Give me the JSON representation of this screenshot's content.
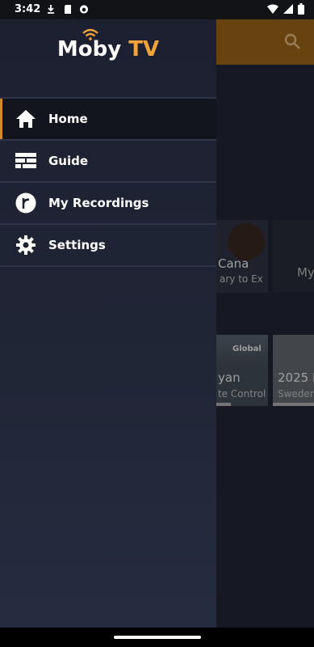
{
  "status_bar": {
    "time": "3:42"
  },
  "app": {
    "logo_main": "Moby",
    "logo_accent": "TV",
    "accent_color": "#f0a33a",
    "header_color": "#a96c1a"
  },
  "drawer": {
    "items": [
      {
        "label": "Home",
        "icon": "home-icon",
        "active": true
      },
      {
        "label": "Guide",
        "icon": "guide-icon"
      },
      {
        "label": "My Recordings",
        "icon": "recordings-icon"
      },
      {
        "label": "Settings",
        "icon": "gear-icon"
      }
    ]
  },
  "background": {
    "row1": [
      {
        "title": "Cana",
        "subtitle": "ary to Ex"
      },
      {
        "title": "My"
      }
    ],
    "row2": [
      {
        "title": "yan",
        "subtitle": "te Control",
        "badge": "Global"
      },
      {
        "title": "2025 I",
        "subtitle": "Sweden"
      }
    ]
  }
}
